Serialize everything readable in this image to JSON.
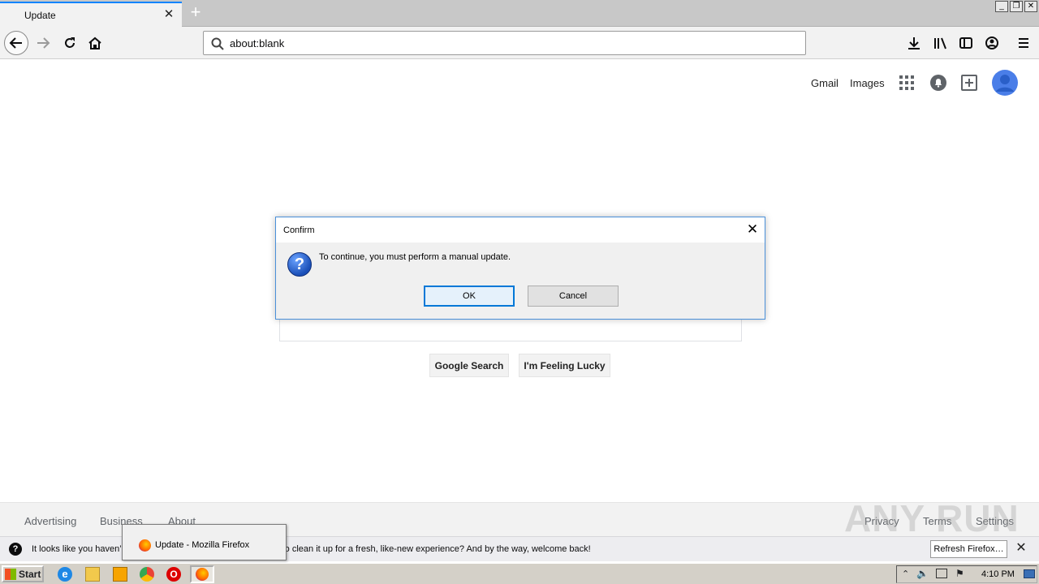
{
  "browser": {
    "tab_title": "Update",
    "url": "about:blank"
  },
  "google": {
    "header_links": [
      "Gmail",
      "Images"
    ],
    "search_button": "Google Search",
    "lucky_button": "I'm Feeling Lucky",
    "footer_left": [
      "Advertising",
      "Business",
      "About"
    ],
    "footer_right": [
      "Privacy",
      "Terms",
      "Settings"
    ]
  },
  "dialog": {
    "title": "Confirm",
    "message": "To continue, you must perform a manual update.",
    "ok_label": "OK",
    "cancel_label": "Cancel"
  },
  "notification": {
    "text_before": "It looks like you haven’",
    "text_after": "o clean it up for a fresh, like-new experience? And by the way, welcome back!",
    "refresh_label": "Refresh Firefox…"
  },
  "taskbar": {
    "start_label": "Start",
    "popup_text": "Update - Mozilla Firefox",
    "clock": "4:10 PM"
  },
  "watermark": "ANY RUN",
  "colors": {
    "accent": "#0a84ff",
    "dialog_border": "#4a90d9",
    "ok_border": "#0078d7",
    "avatar": "#4a7ee8"
  }
}
